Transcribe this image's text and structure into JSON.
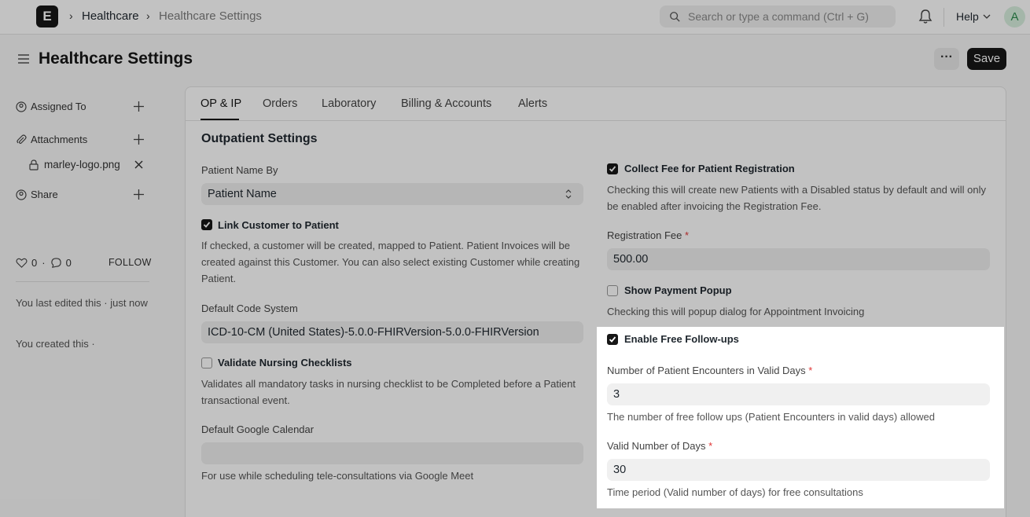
{
  "navbar": {
    "logo_letter": "E",
    "breadcrumb": [
      "Healthcare",
      "Healthcare Settings"
    ],
    "search_placeholder": "Search or type a command (Ctrl + G)",
    "help_label": "Help",
    "avatar_letter": "A"
  },
  "header": {
    "title": "Healthcare Settings",
    "more_label": "···",
    "save_label": "Save"
  },
  "sidebar": {
    "assigned_to": "Assigned To",
    "attachments": "Attachments",
    "attachment_file": "marley-logo.png",
    "share": "Share",
    "likes_count": "0",
    "comments_count": "0",
    "follow_label": "FOLLOW",
    "last_edited": "You last edited this · just now",
    "created": "You created this ·"
  },
  "tabs": [
    "OP & IP",
    "Orders",
    "Laboratory",
    "Billing & Accounts",
    "Alerts"
  ],
  "section": {
    "title": "Outpatient Settings",
    "left": {
      "patient_name_by_label": "Patient Name By",
      "patient_name_by_value": "Patient Name",
      "link_customer_label": "Link Customer to Patient",
      "link_customer_checked": true,
      "link_customer_desc": "If checked, a customer will be created, mapped to Patient. Patient Invoices will be created against this Customer. You can also select existing Customer while creating Patient.",
      "default_code_system_label": "Default Code System",
      "default_code_system_value": "ICD-10-CM (United States)-5.0.0-FHIRVersion-5.0.0-FHIRVersion",
      "validate_nursing_label": "Validate Nursing Checklists",
      "validate_nursing_checked": false,
      "validate_nursing_desc": "Validates all mandatory tasks in nursing checklist to be Completed before a Patient transactional event.",
      "google_calendar_label": "Default Google Calendar",
      "google_calendar_value": "",
      "google_calendar_desc": "For use while scheduling tele-consultations via Google Meet"
    },
    "right": {
      "collect_fee_label": "Collect Fee for Patient Registration",
      "collect_fee_checked": true,
      "collect_fee_desc": "Checking this will create new Patients with a Disabled status by default and will only be enabled after invoicing the Registration Fee.",
      "registration_fee_label": "Registration Fee",
      "registration_fee_value": "500.00",
      "show_payment_label": "Show Payment Popup",
      "show_payment_checked": false,
      "show_payment_desc": "Checking this will popup dialog for Appointment Invoicing",
      "free_followups_label": "Enable Free Follow-ups",
      "free_followups_checked": true,
      "encounters_label": "Number of Patient Encounters in Valid Days",
      "encounters_value": "3",
      "encounters_desc": "The number of free follow ups (Patient Encounters in valid days) allowed",
      "valid_days_label": "Valid Number of Days",
      "valid_days_value": "30",
      "valid_days_desc": "Time period (Valid number of days) for free consultations"
    },
    "required_mark": "*"
  }
}
